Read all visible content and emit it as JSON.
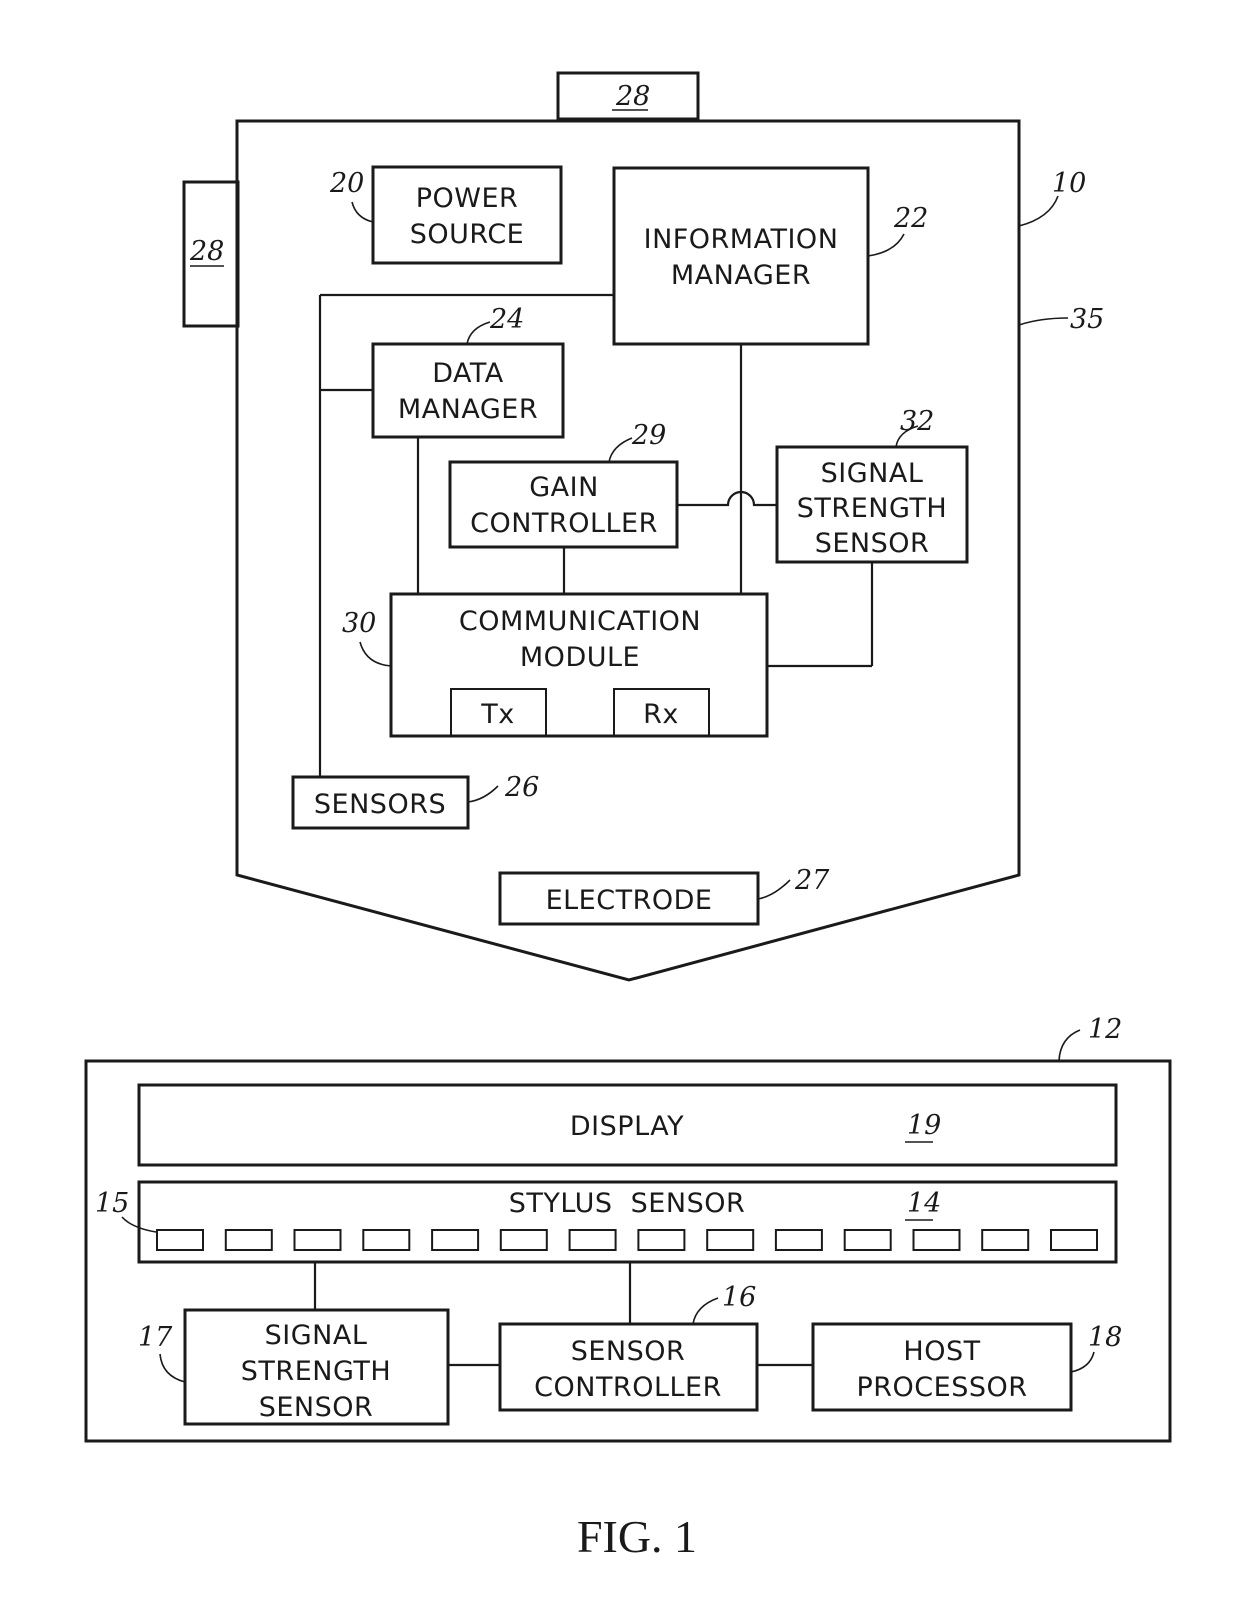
{
  "figure_caption": "FIG. 1",
  "stylus": {
    "ref": "10",
    "housing_ref": "35",
    "tip_ref": "28",
    "side_ref": "28",
    "power_source": {
      "lines": [
        "POWER",
        "SOURCE"
      ],
      "ref": "20"
    },
    "information_manager": {
      "lines": [
        "INFORMATION",
        "MANAGER"
      ],
      "ref": "22"
    },
    "data_manager": {
      "lines": [
        "DATA",
        "MANAGER"
      ],
      "ref": "24"
    },
    "gain_controller": {
      "lines": [
        "GAIN",
        "CONTROLLER"
      ],
      "ref": "29"
    },
    "signal_strength_sensor": {
      "lines": [
        "SIGNAL",
        "STRENGTH",
        "SENSOR"
      ],
      "ref": "32"
    },
    "communication_module": {
      "lines": [
        "COMMUNICATION",
        "MODULE"
      ],
      "ref": "30",
      "tx": "Tx",
      "rx": "Rx"
    },
    "sensors": {
      "label": "SENSORS",
      "ref": "26"
    },
    "electrode": {
      "label": "ELECTRODE",
      "ref": "27"
    }
  },
  "device": {
    "ref": "12",
    "display": {
      "label": "DISPLAY",
      "ref": "19"
    },
    "stylus_sensor": {
      "label": "STYLUS  SENSOR",
      "ref": "14",
      "electrode_ref": "15",
      "electrode_count": 14
    },
    "signal_strength_sensor": {
      "lines": [
        "SIGNAL",
        "STRENGTH",
        "SENSOR"
      ],
      "ref": "17"
    },
    "sensor_controller": {
      "lines": [
        "SENSOR",
        "CONTROLLER"
      ],
      "ref": "16"
    },
    "host_processor": {
      "lines": [
        "HOST",
        "PROCESSOR"
      ],
      "ref": "18"
    }
  }
}
